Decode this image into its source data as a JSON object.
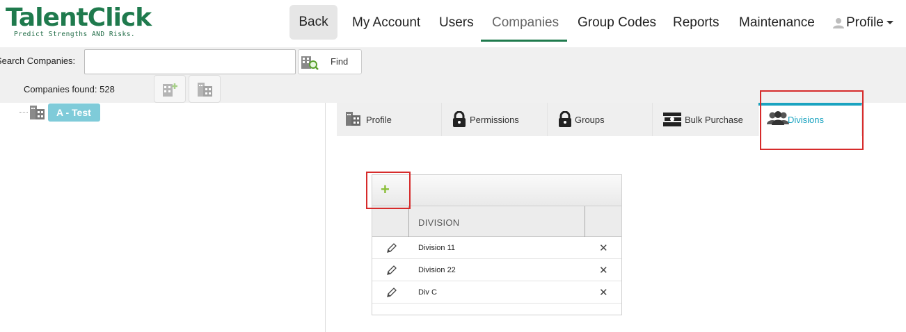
{
  "brand": {
    "name": "TalentClick",
    "tagline": "Predict Strengths AND Risks."
  },
  "nav": {
    "back": "Back",
    "my_account": "My Account",
    "users": "Users",
    "companies": "Companies",
    "group_codes": "Group Codes",
    "reports": "Reports",
    "maintenance": "Maintenance",
    "profile": "Profile",
    "active": "Companies"
  },
  "search": {
    "label": "Search Companies:",
    "value": "",
    "find_label": "Find",
    "found_text": "Companies found: 528"
  },
  "tree": {
    "node_label": "A - Test"
  },
  "tabs": [
    {
      "label": "Profile",
      "icon": "building-icon"
    },
    {
      "label": "Permissions",
      "icon": "lock-icon"
    },
    {
      "label": "Groups",
      "icon": "lock-icon"
    },
    {
      "label": "Bulk Purchase",
      "icon": "money-stack-icon"
    },
    {
      "label": "Divisions",
      "icon": "users-icon",
      "active": true
    }
  ],
  "divisions": {
    "add_label": "+",
    "column_header": "DIVISION",
    "rows": [
      {
        "name": "Division 11"
      },
      {
        "name": "Division 22"
      },
      {
        "name": "Div C"
      }
    ]
  },
  "colors": {
    "brand_green": "#1f7a4d",
    "active_tab": "#1aa3c0",
    "highlight_red": "#d62b2b",
    "add_green": "#8bbf3a",
    "tree_node": "#7fcbd9"
  }
}
